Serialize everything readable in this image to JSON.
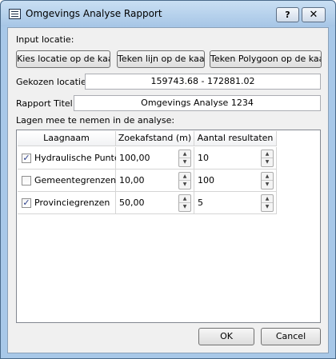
{
  "window": {
    "title": "Omgevings Analyse Rapport",
    "help_label": "?",
    "close_label": "✕"
  },
  "input": {
    "section_label": "Input locatie:",
    "buttons": [
      "Kies locatie op de kaart",
      "Teken lijn op de kaart",
      "Teken Polygoon op de kaart"
    ],
    "location_label": "Gekozen locatie:",
    "location_value": "159743.68 - 172881.02",
    "report_title_label": "Rapport Titel:",
    "report_title_value": "Omgevings Analyse 1234"
  },
  "layers": {
    "section_label": "Lagen mee te nemen in de analyse:",
    "columns": [
      "Laagnaam",
      "Zoekafstand (m)",
      "Aantal resultaten"
    ],
    "rows": [
      {
        "name": "Hydraulische Punten",
        "checked": true,
        "distance": "100,00",
        "results": "10"
      },
      {
        "name": "Gemeentegrenzen",
        "checked": false,
        "distance": "10,00",
        "results": "100"
      },
      {
        "name": "Provinciegrenzen",
        "checked": true,
        "distance": "50,00",
        "results": "5"
      }
    ]
  },
  "footer": {
    "ok_label": "OK",
    "cancel_label": "Cancel"
  },
  "icons": {
    "window_icon": "report-icon",
    "checkbox_check": "✓",
    "spin_up": "▲",
    "spin_down": "▼"
  },
  "colors": {
    "title_bar": "#a8c8e8",
    "dialog_bg": "#f0f0f0",
    "check": "#2b3e8a"
  }
}
